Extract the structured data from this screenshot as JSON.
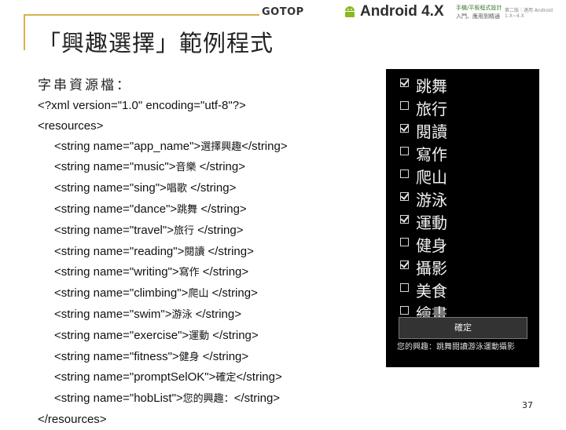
{
  "header": {
    "gotop": "GOTOP",
    "brand": "Android",
    "version": "4.X",
    "tagline_top": "手機/平板程式設計",
    "tagline_bottom": "入門、應用到精通",
    "edition": "第二版｜適用 Android 1.X~4.X"
  },
  "title": "「興趣選擇」範例程式",
  "subtitle": "字串資源檔：",
  "code": {
    "xml_decl": "<?xml version=\"1.0\" encoding=\"utf-8\"?>",
    "open_tag": "<resources>",
    "lines": [
      {
        "pre": "<string name=\"app_name\">",
        "value": "選擇興趣",
        "post": "</string>"
      },
      {
        "pre": "<string name=\"music\">",
        "value": "音樂 ",
        "post": "</string>"
      },
      {
        "pre": "<string name=\"sing\">",
        "value": "唱歌 ",
        "post": "</string>"
      },
      {
        "pre": "<string name=\"dance\">",
        "value": "跳舞 ",
        "post": "</string>"
      },
      {
        "pre": "<string name=\"travel\">",
        "value": "旅行 ",
        "post": "</string>"
      },
      {
        "pre": "<string name=\"reading\">",
        "value": "閱讀 ",
        "post": "</string>"
      },
      {
        "pre": "<string name=\"writing\">",
        "value": "寫作 ",
        "post": "</string>"
      },
      {
        "pre": "<string name=\"climbing\">",
        "value": "爬山 ",
        "post": "</string>"
      },
      {
        "pre": "<string name=\"swim\">",
        "value": "游泳 ",
        "post": "</string>"
      },
      {
        "pre": "<string name=\"exercise\">",
        "value": "運動 ",
        "post": "</string>"
      },
      {
        "pre": "<string name=\"fitness\">",
        "value": "健身 ",
        "post": "</string>"
      },
      {
        "pre": "<string name=\"promptSelOK\">",
        "value": "確定",
        "post": "</string>"
      },
      {
        "pre": "<string name=\"hobList\">",
        "value": "您的興趣：",
        "post": "</string>"
      }
    ],
    "close_tag": "</resources>"
  },
  "phone": {
    "checkboxes": [
      {
        "label": "跳舞",
        "checked": true
      },
      {
        "label": "旅行",
        "checked": false
      },
      {
        "label": "閱讀",
        "checked": true
      },
      {
        "label": "寫作",
        "checked": false
      },
      {
        "label": "爬山",
        "checked": false
      },
      {
        "label": "游泳",
        "checked": true
      },
      {
        "label": "運動",
        "checked": true
      },
      {
        "label": "健身",
        "checked": false
      },
      {
        "label": "攝影",
        "checked": true
      },
      {
        "label": "美食",
        "checked": false
      },
      {
        "label": "繪畫",
        "checked": false
      }
    ],
    "ok_label": "確定",
    "prompt_text": "您的興趣：跳舞閱讀游泳運動攝影"
  },
  "page_number": "37",
  "colors": {
    "accent_line": "#d6b14a",
    "phone_bg": "#000000"
  }
}
